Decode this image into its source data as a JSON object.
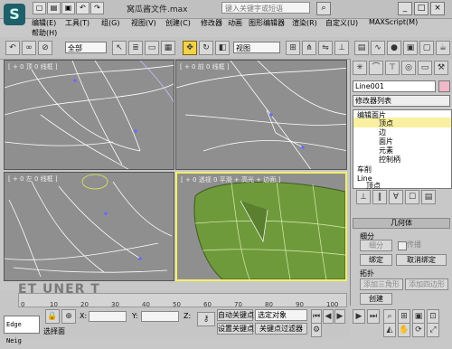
{
  "app": {
    "title": "窝瓜酱文件.max",
    "search_placeholder": "键入关键字或短语"
  },
  "menu": [
    "编辑(E)",
    "工具(T)",
    "组(G)",
    "视图(V)",
    "创建(C)",
    "修改器",
    "动画",
    "图形编辑器",
    "渲染(R)",
    "自定义(U)",
    "MAXScript(M)",
    "帮助(H)"
  ],
  "toolbar": {
    "selection_filter": "全部",
    "reference_coord": "视图"
  },
  "viewports": [
    {
      "label": "[ + 0 顶 0 线框 ]"
    },
    {
      "label": "[ + 0 前 0 线框 ]"
    },
    {
      "label": "[ + 0 左 0 线框 ]"
    },
    {
      "label": "[ + 0 透视 0 平滑 + 高光 + 边面 ]"
    }
  ],
  "command_panel": {
    "object_name": "Line001",
    "modifier_list": "修改器列表",
    "stack": [
      "编辑面片",
      "顶点",
      "边",
      "面片",
      "元素",
      "控制柄",
      "车削",
      "Line",
      "顶点"
    ],
    "geometry_rollout": "几何体",
    "subdivide_group": "细分",
    "subdivide_btn": "细分",
    "propagate_label": "传播",
    "bind_btn": "绑定",
    "unbind_btn": "取消绑定",
    "topology_group": "拓扑",
    "add_tri_btn": "添加三角形",
    "add_quad_btn": "添加四边形",
    "create_btn": "创建"
  },
  "timeline": {
    "ticks": [
      "0",
      "10",
      "20",
      "30",
      "40",
      "50",
      "60",
      "70",
      "80",
      "90",
      "100"
    ]
  },
  "status": {
    "maxscript_box": "Edge Neig",
    "prompt": "选择面",
    "x_label": "X:",
    "y_label": "Y:",
    "z_label": "Z:",
    "auto_key": "自动关键点",
    "selected_obj": "选定对象",
    "set_key": "设置关键点",
    "key_filter": "关键点过滤器",
    "watermark": "ET UNER T"
  },
  "colors": {
    "accent_yellow": "#f3ef6a",
    "viewport_bg": "#8f8f8f",
    "mesh_green": "#6f9a3c"
  }
}
